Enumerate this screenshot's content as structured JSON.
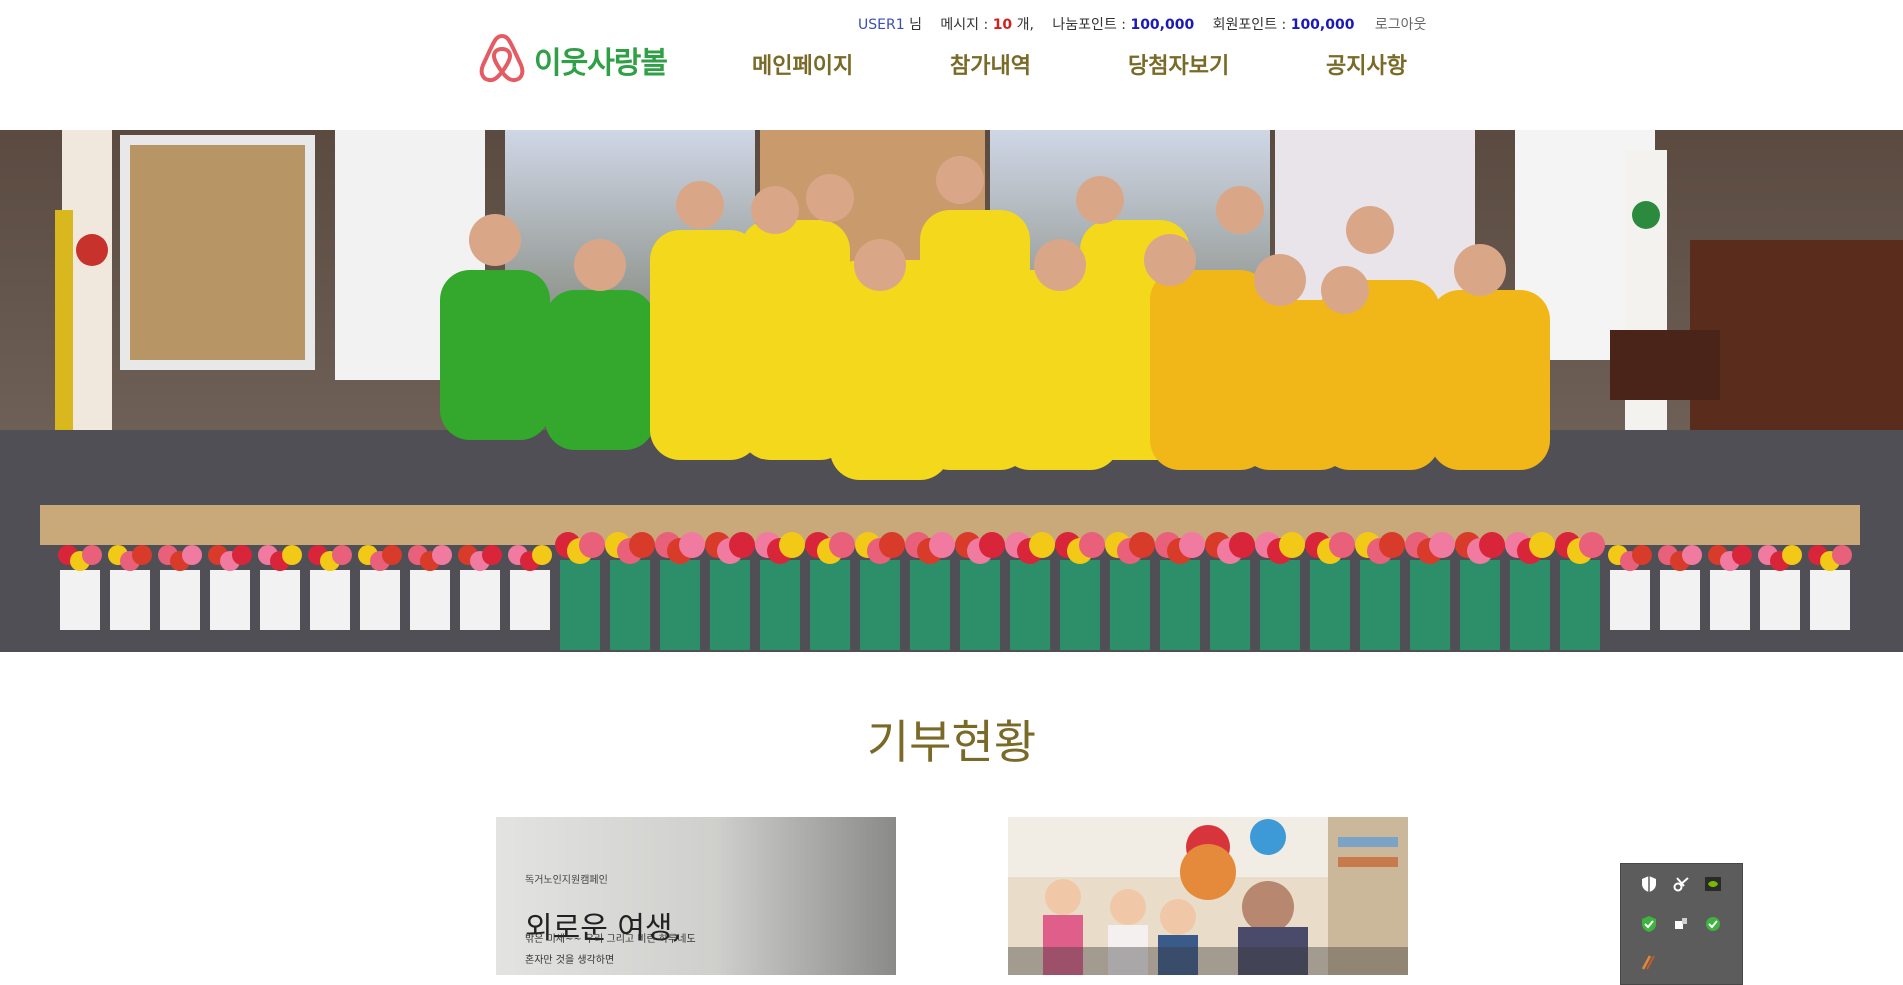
{
  "header": {
    "user_name": "USER1",
    "user_suffix": "님",
    "messages_label": "메시지 :",
    "messages_count": "10",
    "messages_unit": "개,",
    "share_points_label": "나눔포인트 :",
    "share_points_value": "100,000",
    "member_points_label": "회원포인트 :",
    "member_points_value": "100,000",
    "logout_label": "로그아웃"
  },
  "logo": {
    "text": "이웃사랑볼",
    "icon": "airbnb-style-logo-icon"
  },
  "nav": {
    "items": [
      {
        "label": "메인페이지"
      },
      {
        "label": "참가내역"
      },
      {
        "label": "당첨자보기"
      },
      {
        "label": "공지사항"
      }
    ]
  },
  "hero": {
    "description_icon": "volunteer-group-photo"
  },
  "donation": {
    "title": "기부현황",
    "cards": [
      {
        "tag": "독거노인지원캠페인",
        "title": "외로운 여생,",
        "subtitle_line1": "밖은 미세~~ 우리 그리고 비린 하루네도",
        "subtitle_line2": "혼자만 것을 생각하면"
      },
      {
        "image_icon": "children-christmas-photo"
      }
    ]
  },
  "tray": {
    "icons": [
      "shield-icon",
      "snipping-tool-icon",
      "nvidia-icon",
      "vaccine-check-icon",
      "usb-device-icon",
      "network-icon",
      "pen-tool-icon"
    ]
  },
  "colors": {
    "brand_green": "#2fa046",
    "nav_text": "#7a6a28",
    "points_blue": "#1a1ab8",
    "message_red": "#d21f1f",
    "logo_pink": "#e45b63"
  }
}
